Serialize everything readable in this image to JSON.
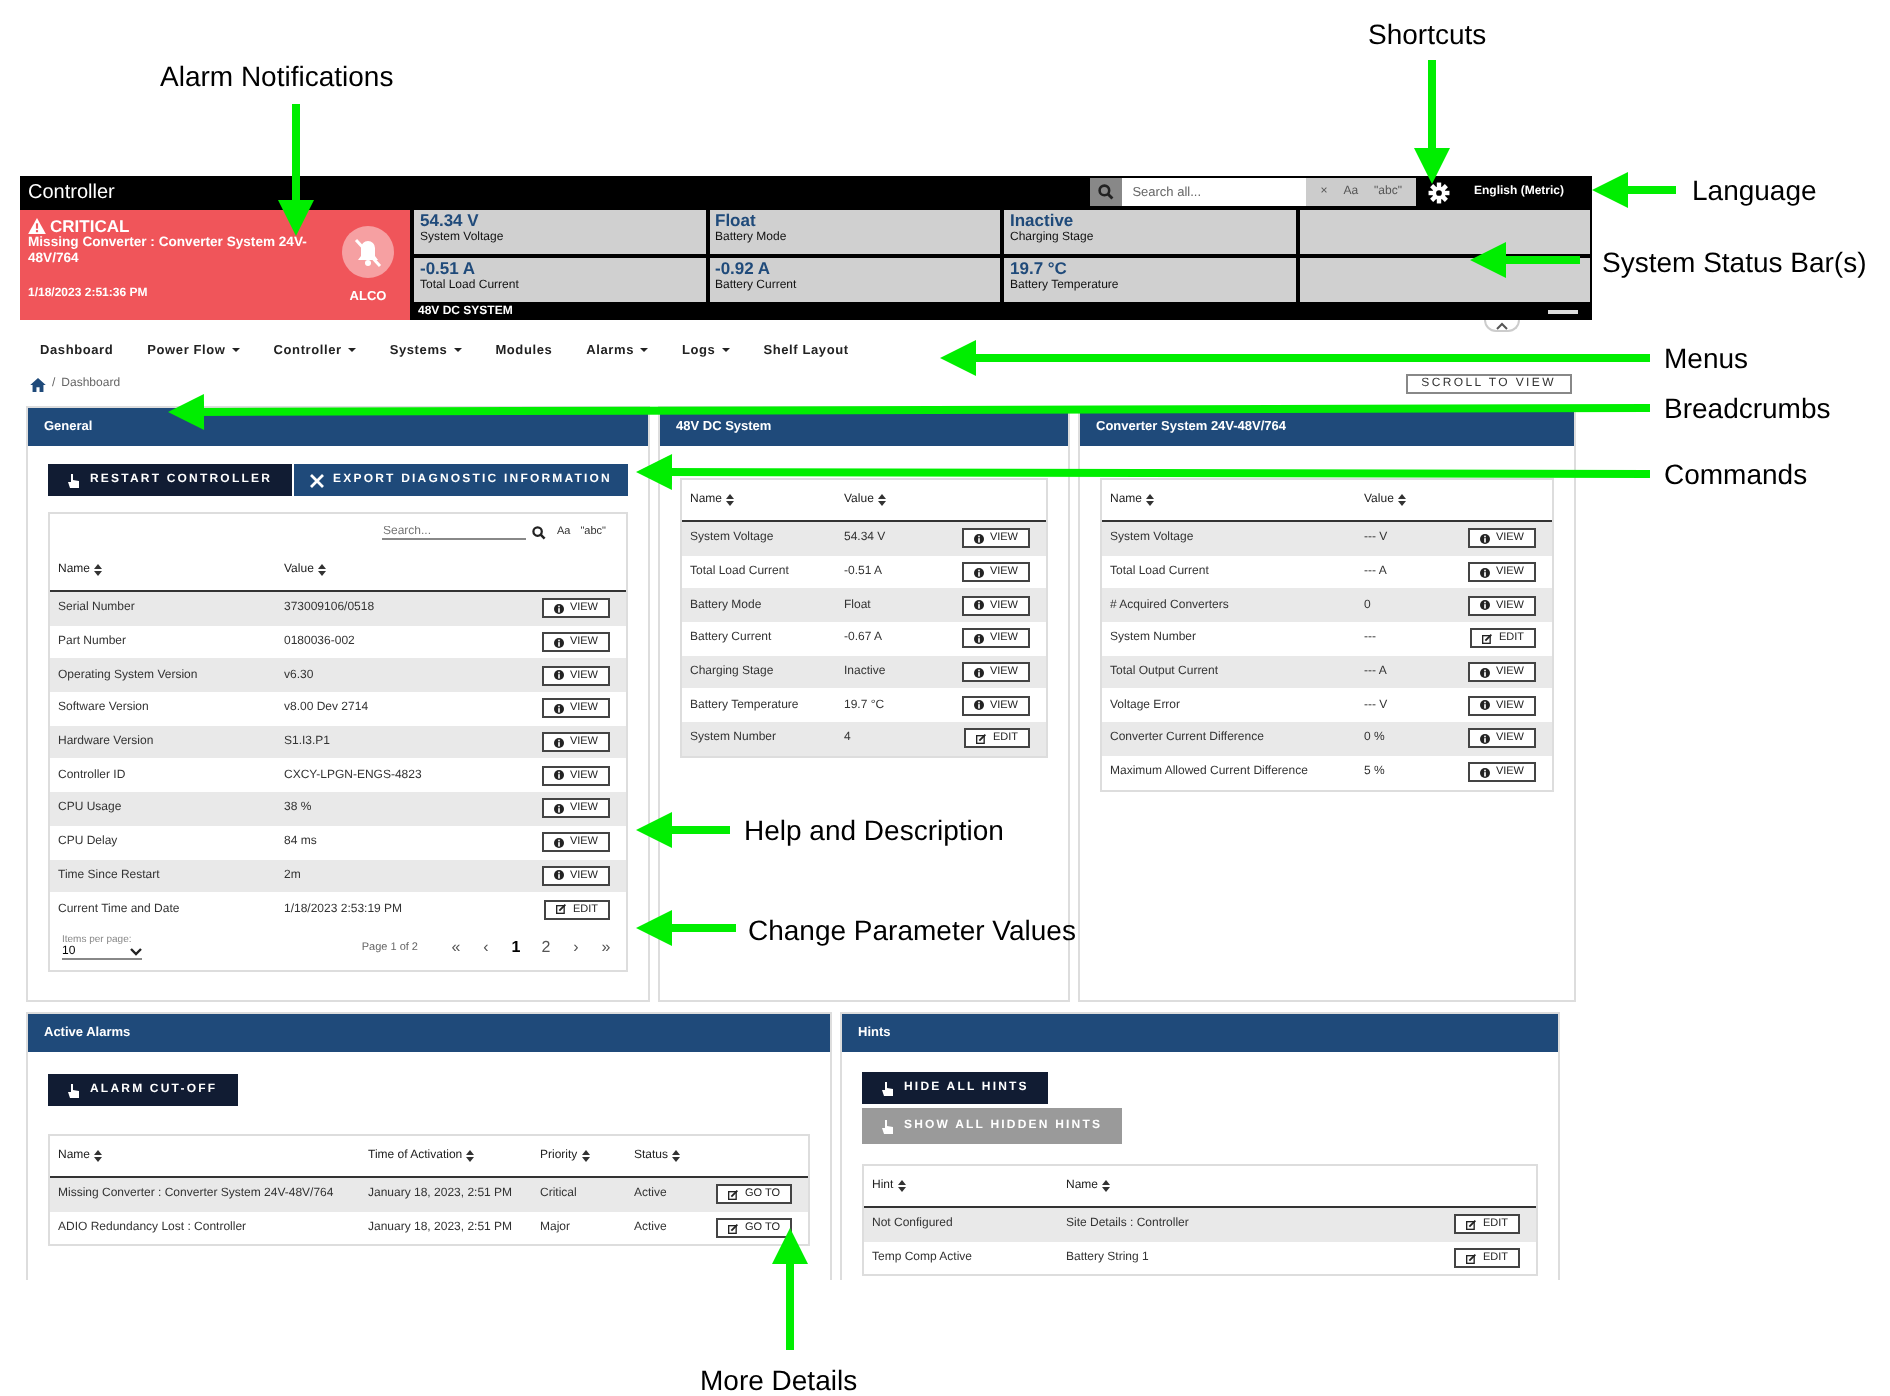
{
  "header": {
    "title": "Controller",
    "search": {
      "placeholder": "Search all...",
      "clear": "×",
      "case": "Aa",
      "exact": "\"abc\""
    },
    "language": "English (Metric)"
  },
  "alarm_banner": {
    "severity": "CRITICAL",
    "message": "Missing Converter : Converter System 24V-48V/764",
    "time": "1/18/2023 2:51:36 PM",
    "mute": "ALCO"
  },
  "status_tiles": [
    [
      {
        "kind": "value",
        "value": "54.34 V",
        "label": "System Voltage"
      },
      {
        "kind": "value",
        "value": "Float",
        "label": "Battery Mode"
      },
      {
        "kind": "value",
        "value": "Inactive",
        "label": "Charging Stage"
      },
      {
        "kind": "blank"
      }
    ],
    [
      {
        "kind": "value",
        "value": "-0.51 A",
        "label": "Total Load Current"
      },
      {
        "kind": "value",
        "value": "-0.92 A",
        "label": "Battery Current"
      },
      {
        "kind": "value",
        "value": "19.7 °C",
        "label": "Battery Temperature"
      },
      {
        "kind": "blank"
      }
    ]
  ],
  "status_caption": "48V DC SYSTEM",
  "menu": [
    {
      "label": "Dashboard",
      "dropdown": false
    },
    {
      "label": "Power Flow",
      "dropdown": true
    },
    {
      "label": "Controller",
      "dropdown": true
    },
    {
      "label": "Systems",
      "dropdown": true
    },
    {
      "label": "Modules",
      "dropdown": false
    },
    {
      "label": "Alarms",
      "dropdown": true
    },
    {
      "label": "Logs",
      "dropdown": true
    },
    {
      "label": "Shelf Layout",
      "dropdown": false
    }
  ],
  "breadcrumbs": [
    {
      "separator": "/",
      "label": "Dashboard"
    }
  ],
  "scroll_button": "SCROLL TO VIEW",
  "general": {
    "title": "General",
    "commands": [
      {
        "label": "RESTART CONTROLLER",
        "kind": "dark"
      },
      {
        "label": "EXPORT DIAGNOSTIC INFORMATION",
        "kind": "blue"
      }
    ],
    "search": {
      "placeholder": "Search...",
      "case": "Aa",
      "exact": "\"abc\""
    },
    "columns": [
      "Name",
      "Value"
    ],
    "rows": [
      {
        "name": "Serial Number",
        "value": "373009106/0518",
        "action": {
          "kind": "view",
          "label": "VIEW"
        }
      },
      {
        "name": "Part Number",
        "value": "0180036-002",
        "action": {
          "kind": "view",
          "label": "VIEW"
        }
      },
      {
        "name": "Operating System Version",
        "value": "v6.30",
        "action": {
          "kind": "view",
          "label": "VIEW"
        }
      },
      {
        "name": "Software Version",
        "value": "v8.00 Dev 2714",
        "action": {
          "kind": "view",
          "label": "VIEW"
        }
      },
      {
        "name": "Hardware Version",
        "value": "S1.I3.P1",
        "action": {
          "kind": "view",
          "label": "VIEW"
        }
      },
      {
        "name": "Controller ID",
        "value": "CXCY-LPGN-ENGS-4823",
        "action": {
          "kind": "view",
          "label": "VIEW"
        }
      },
      {
        "name": "CPU Usage",
        "value": "38 %",
        "action": {
          "kind": "view",
          "label": "VIEW"
        }
      },
      {
        "name": "CPU Delay",
        "value": "84 ms",
        "action": {
          "kind": "view",
          "label": "VIEW"
        }
      },
      {
        "name": "Time Since Restart",
        "value": "2m",
        "action": {
          "kind": "view",
          "label": "VIEW"
        }
      },
      {
        "name": "Current Time and Date",
        "value": "1/18/2023 2:53:19 PM",
        "action": {
          "kind": "edit",
          "label": "EDIT"
        }
      }
    ],
    "items_per_page_label": "Items per page:",
    "items_per_page": "10",
    "page_info": "Page 1 of 2",
    "pager": [
      {
        "label": "«",
        "selected": false
      },
      {
        "label": "‹",
        "selected": false
      },
      {
        "label": "1",
        "selected": true
      },
      {
        "label": "2",
        "selected": false
      },
      {
        "label": "›",
        "selected": false
      },
      {
        "label": "»",
        "selected": false
      }
    ]
  },
  "dc_system": {
    "title": "48V DC System",
    "columns": [
      "Name",
      "Value"
    ],
    "rows": [
      {
        "name": "System Voltage",
        "value": "54.34 V",
        "action": {
          "kind": "view",
          "label": "VIEW"
        }
      },
      {
        "name": "Total Load Current",
        "value": "-0.51 A",
        "action": {
          "kind": "view",
          "label": "VIEW"
        }
      },
      {
        "name": "Battery Mode",
        "value": "Float",
        "action": {
          "kind": "view",
          "label": "VIEW"
        }
      },
      {
        "name": "Battery Current",
        "value": "-0.67 A",
        "action": {
          "kind": "view",
          "label": "VIEW"
        }
      },
      {
        "name": "Charging Stage",
        "value": "Inactive",
        "action": {
          "kind": "view",
          "label": "VIEW"
        }
      },
      {
        "name": "Battery Temperature",
        "value": "19.7 °C",
        "action": {
          "kind": "view",
          "label": "VIEW"
        }
      },
      {
        "name": "System Number",
        "value": "4",
        "action": {
          "kind": "edit",
          "label": "EDIT"
        }
      }
    ]
  },
  "converter_system": {
    "title": "Converter System 24V-48V/764",
    "columns": [
      "Name",
      "Value"
    ],
    "rows": [
      {
        "name": "System Voltage",
        "value": "--- V",
        "action": {
          "kind": "view",
          "label": "VIEW"
        }
      },
      {
        "name": "Total Load Current",
        "value": "--- A",
        "action": {
          "kind": "view",
          "label": "VIEW"
        }
      },
      {
        "name": "# Acquired Converters",
        "value": "0",
        "action": {
          "kind": "view",
          "label": "VIEW"
        }
      },
      {
        "name": "System Number",
        "value": "---",
        "action": {
          "kind": "edit",
          "label": "EDIT"
        }
      },
      {
        "name": "Total Output Current",
        "value": "--- A",
        "action": {
          "kind": "view",
          "label": "VIEW"
        }
      },
      {
        "name": "Voltage Error",
        "value": "--- V",
        "action": {
          "kind": "view",
          "label": "VIEW"
        }
      },
      {
        "name": "Converter Current Difference",
        "value": "0 %",
        "action": {
          "kind": "view",
          "label": "VIEW"
        }
      },
      {
        "name": "Maximum Allowed Current Difference",
        "value": "5 %",
        "action": {
          "kind": "view",
          "label": "VIEW"
        }
      }
    ]
  },
  "active_alarms": {
    "title": "Active Alarms",
    "commands": [
      {
        "label": "ALARM CUT-OFF",
        "kind": "dark",
        "disabled": false
      }
    ],
    "columns": [
      "Name",
      "Time of Activation",
      "Priority",
      "Status"
    ],
    "rows": [
      {
        "name": "Missing Converter : Converter System 24V-48V/764",
        "time": "January 18, 2023, 2:51 PM",
        "priority": "Critical",
        "status": "Active",
        "action": "GO TO"
      },
      {
        "name": "ADIO Redundancy Lost : Controller",
        "time": "January 18, 2023, 2:51 PM",
        "priority": "Major",
        "status": "Active",
        "action": "GO TO"
      }
    ]
  },
  "hints": {
    "title": "Hints",
    "commands": [
      {
        "label": "HIDE ALL HINTS",
        "kind": "dark",
        "disabled": false
      },
      {
        "label": "SHOW ALL HIDDEN HINTS",
        "kind": "dark",
        "disabled": true
      }
    ],
    "columns": [
      "Hint",
      "Name"
    ],
    "rows": [
      {
        "hint": "Not Configured",
        "name": "Site Details : Controller",
        "action": {
          "kind": "edit",
          "label": "EDIT"
        }
      },
      {
        "hint": "Temp Comp Active",
        "name": "Battery String 1",
        "action": {
          "kind": "edit",
          "label": "EDIT"
        }
      }
    ]
  },
  "annotations": [
    "Alarm Notifications",
    "Shortcuts",
    "Language",
    "System Status Bar(s)",
    "Menus",
    "Breadcrumbs",
    "Commands",
    "Help and Description",
    "Change Parameter Values",
    "More Details"
  ]
}
